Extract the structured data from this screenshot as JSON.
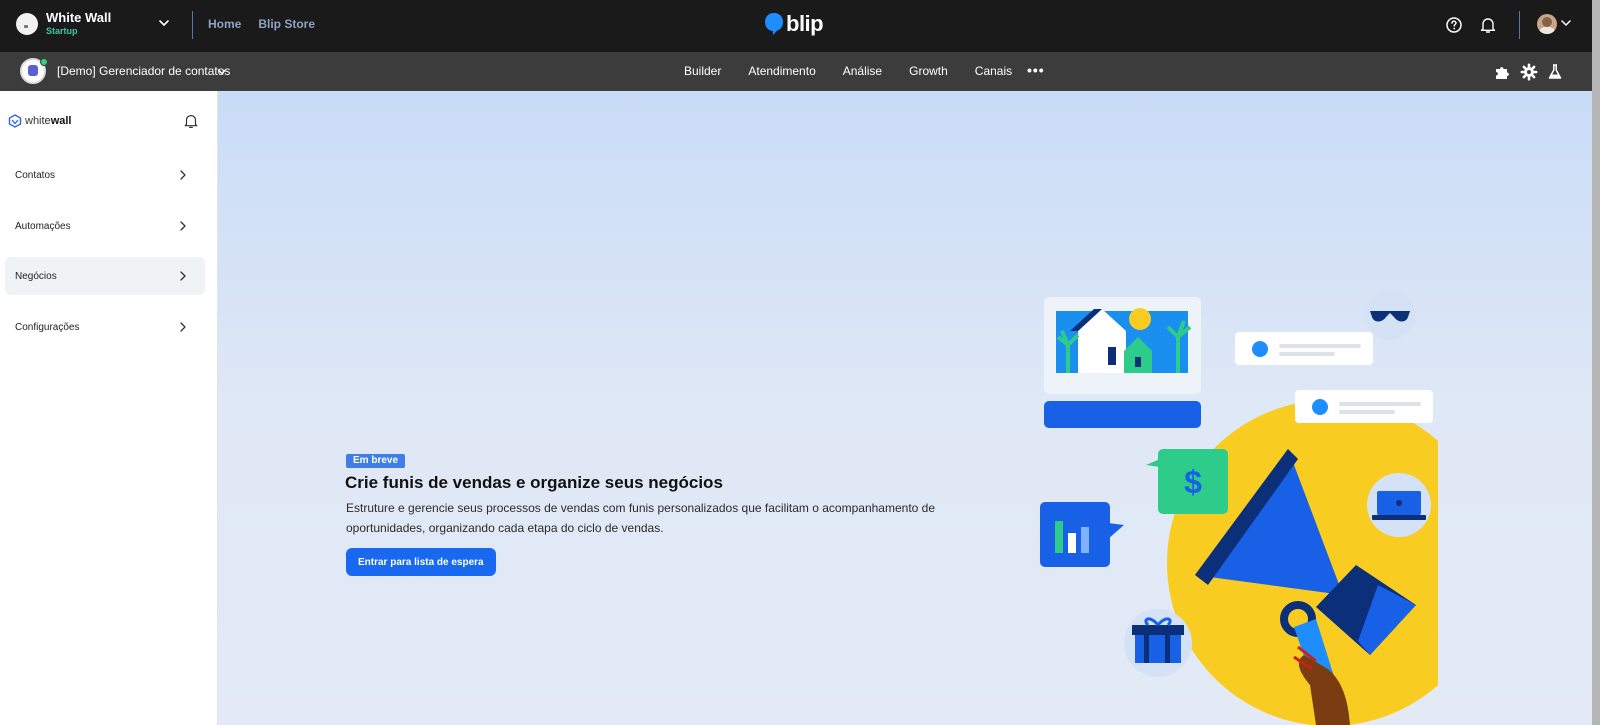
{
  "topbar": {
    "org_name": "White Wall",
    "org_plan": "Startup",
    "nav": [
      "Home",
      "Blip Store"
    ],
    "brand": "blip"
  },
  "subbar": {
    "bot_name": "[Demo] Gerenciador de contatos",
    "nav": [
      "Builder",
      "Atendimento",
      "Análise",
      "Growth",
      "Canais"
    ],
    "more": "•••"
  },
  "sidebar": {
    "logo_light": "white",
    "logo_bold": "wall",
    "items": [
      {
        "label": "Contatos"
      },
      {
        "label": "Automações"
      },
      {
        "label": "Negócios"
      },
      {
        "label": "Configurações"
      }
    ],
    "active_item": "Negócios"
  },
  "main": {
    "badge": "Em breve",
    "headline": "Crie funis de vendas e organize seus negócios",
    "description": "Estruture e gerencie seus processos de vendas com funis personalizados que facilitam o acompanhamento de oportunidades, organizando cada etapa do ciclo de vendas.",
    "cta_label": "Entrar para lista de espera",
    "illustration_dollar": "$"
  },
  "colors": {
    "topbar_bg": "#1a1a1a",
    "subbar_bg": "#3c3c3c",
    "accent_blue": "#1968f0",
    "badge_blue": "#3f7de8",
    "plan_green": "#3cc8a3",
    "illustration_yellow": "#f9cc22"
  },
  "icons": [
    "help-icon",
    "bell-icon",
    "chevron-down-icon",
    "puzzle-icon",
    "gear-icon",
    "flask-icon",
    "chevron-right-icon",
    "megaphone-illustration"
  ]
}
